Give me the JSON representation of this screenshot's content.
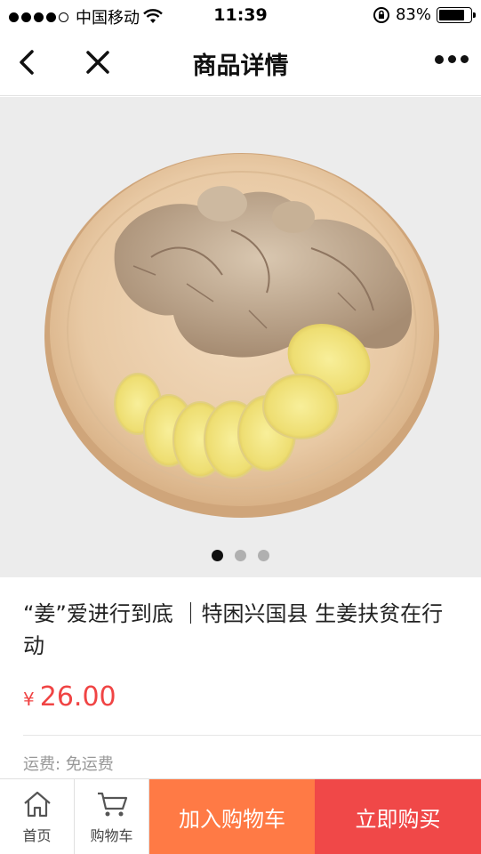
{
  "status_bar": {
    "carrier": "中国移动",
    "time": "11:39",
    "battery": "83%",
    "battery_level": 0.83
  },
  "nav": {
    "title": "商品详情"
  },
  "gallery": {
    "image": "ginger-on-wooden-plate",
    "slide_count": 3,
    "active_index": 0
  },
  "product": {
    "title": "“姜”爱进行到底 ｜特困兴国县 生姜扶贫在行动",
    "currency": "¥",
    "price": "26.00",
    "shipping": "运费: 免运费"
  },
  "bottom_bar": {
    "home_label": "首页",
    "cart_label": "购物车",
    "add_to_cart": "加入购物车",
    "buy_now": "立即购买"
  },
  "colors": {
    "price": "#f04444",
    "cart_button": "#ff7a45",
    "buy_button": "#f04848"
  }
}
